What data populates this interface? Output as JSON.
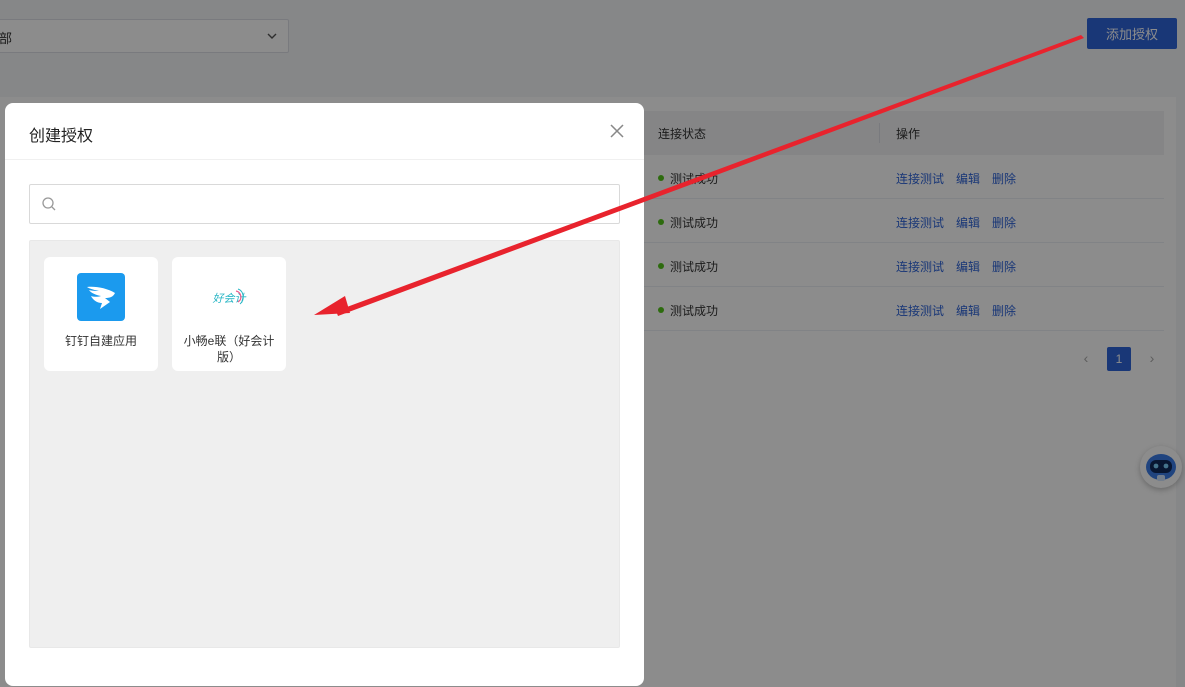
{
  "background": {
    "filter": {
      "value": "部"
    },
    "add_button": "添加授权",
    "table": {
      "headers": {
        "status": "连接状态",
        "actions": "操作"
      },
      "rows": [
        {
          "status": "测试成功",
          "ops": [
            "连接测试",
            "编辑",
            "删除"
          ]
        },
        {
          "status": "测试成功",
          "ops": [
            "连接测试",
            "编辑",
            "删除"
          ]
        },
        {
          "status": "测试成功",
          "ops": [
            "连接测试",
            "编辑",
            "删除"
          ]
        },
        {
          "status": "测试成功",
          "ops": [
            "连接测试",
            "编辑",
            "删除"
          ]
        }
      ]
    },
    "pagination": {
      "current": "1",
      "prev": "‹",
      "next": "›"
    }
  },
  "modal": {
    "title": "创建授权",
    "search": {
      "value": "",
      "placeholder": ""
    },
    "apps": [
      {
        "name": "钉钉自建应用",
        "icon": "dingtalk-icon",
        "color": "#1b9aee"
      },
      {
        "name": "小畅e联（好会计版）",
        "icon": "haokuaiji-logo",
        "logo_text": "好会计"
      }
    ]
  },
  "colors": {
    "primary": "#2f64d9",
    "success": "#52c41a",
    "annotation": "#e8232d"
  }
}
